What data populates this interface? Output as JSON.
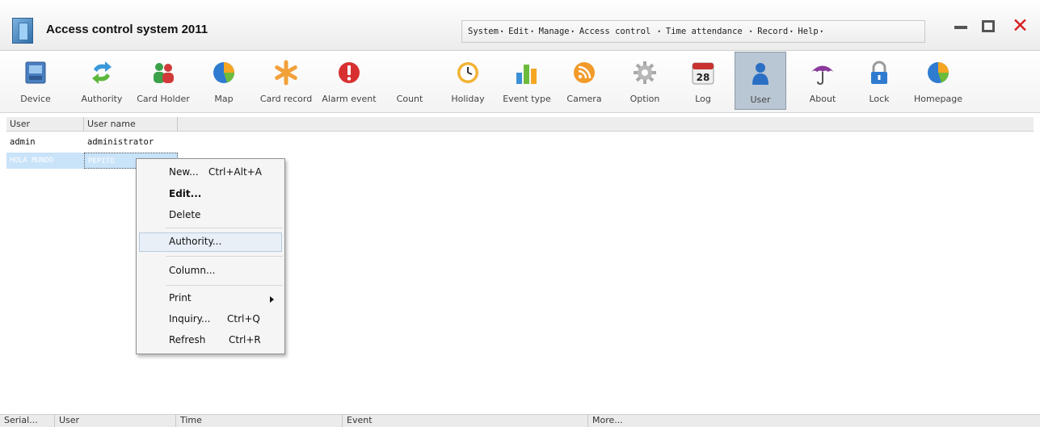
{
  "window": {
    "title": "Access control system 2011",
    "menu": [
      {
        "label": "System",
        "arrow": "▾"
      },
      {
        "label": "Edit",
        "arrow": "▾"
      },
      {
        "label": "Manage",
        "arrow": "▾"
      },
      {
        "label": "Access control",
        "arrow": "▾"
      },
      {
        "label": "Time attendance",
        "arrow": "▾"
      },
      {
        "label": "Record",
        "arrow": "▾"
      },
      {
        "label": "Help",
        "arrow": "▾"
      }
    ],
    "close_glyph": "✕"
  },
  "toolbar": {
    "items": [
      {
        "label": "Device",
        "icon": "device-icon"
      },
      {
        "label": "Authority",
        "icon": "refresh-arrows-icon"
      },
      {
        "label": "Card Holder",
        "icon": "people-icon"
      },
      {
        "label": "Map",
        "icon": "pie-chart-icon"
      },
      {
        "label": "Card record",
        "icon": "asterisk-icon"
      },
      {
        "label": "Alarm event",
        "icon": "alarm-icon"
      },
      {
        "label": "Count",
        "icon": "count-icon"
      },
      {
        "label": "Holiday",
        "icon": "clock-icon"
      },
      {
        "label": "Event type",
        "icon": "bar-chart-icon"
      },
      {
        "label": "Camera",
        "icon": "rss-icon"
      },
      {
        "label": "Option",
        "icon": "gear-icon"
      },
      {
        "label": "Log",
        "icon": "calendar-icon",
        "calendar_day": "28"
      },
      {
        "label": "User",
        "icon": "user-icon",
        "active": true
      },
      {
        "label": "About",
        "icon": "umbrella-icon"
      },
      {
        "label": "Lock",
        "icon": "lock-icon"
      },
      {
        "label": "Homepage",
        "icon": "pie-chart-icon"
      }
    ]
  },
  "user_table": {
    "columns": [
      "User",
      "User name"
    ],
    "rows": [
      {
        "user": "admin",
        "user_name": "administrator",
        "selected": false
      },
      {
        "user": "HOLA MUNDO",
        "user_name": "PEPITO",
        "selected": true
      }
    ]
  },
  "context_menu": {
    "items": [
      {
        "label": "New...",
        "shortcut": "Ctrl+Alt+A"
      },
      {
        "label": "Edit...",
        "bold": true
      },
      {
        "label": "Delete"
      },
      {
        "label": "Authority...",
        "highlighted": true
      },
      {
        "label": "Column..."
      },
      {
        "label": "Print",
        "submenu": true
      },
      {
        "label": "Inquiry...",
        "shortcut": "Ctrl+Q"
      },
      {
        "label": "Refresh",
        "shortcut": "Ctrl+R"
      }
    ]
  },
  "log_table": {
    "columns": [
      "Serial...",
      "User",
      "Time",
      "Event",
      "More..."
    ]
  },
  "colors": {
    "accent_selected_row": "#c9e3f9",
    "active_tool": "#b9c6d3",
    "close_red": "#d62020"
  }
}
